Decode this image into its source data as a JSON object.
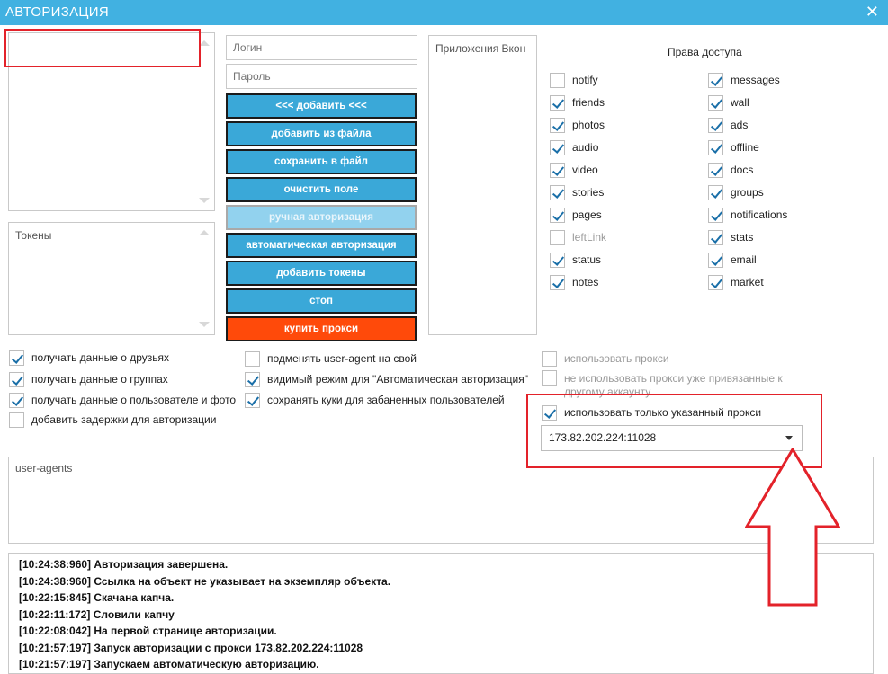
{
  "window": {
    "title": "АВТОРИЗАЦИЯ",
    "close_glyph": "✕"
  },
  "accounts_box": {
    "label": ""
  },
  "tokens_box": {
    "label": "Токены"
  },
  "apps_box": {
    "label": "Приложения Вкон"
  },
  "login": {
    "placeholder": "Логин",
    "value": ""
  },
  "password": {
    "placeholder": "Пароль",
    "value": ""
  },
  "buttons": {
    "add": "<<< добавить <<<",
    "add_from_file": "добавить из файла",
    "save_to_file": "сохранить в файл",
    "clear_field": "очистить поле",
    "manual_auth": "ручная авторизация",
    "auto_auth": "автоматическая авторизация",
    "add_tokens": "добавить токены",
    "stop": "стоп",
    "buy_proxy": "купить прокси"
  },
  "access": {
    "title": "Права доступа",
    "left": [
      {
        "label": "notify",
        "checked": false
      },
      {
        "label": "friends",
        "checked": true
      },
      {
        "label": "photos",
        "checked": true
      },
      {
        "label": "audio",
        "checked": true
      },
      {
        "label": "video",
        "checked": true
      },
      {
        "label": "stories",
        "checked": true
      },
      {
        "label": "pages",
        "checked": true
      },
      {
        "label": "leftLink",
        "checked": false
      },
      {
        "label": "status",
        "checked": true
      },
      {
        "label": "notes",
        "checked": true
      }
    ],
    "right": [
      {
        "label": "messages",
        "checked": true
      },
      {
        "label": "wall",
        "checked": true
      },
      {
        "label": "ads",
        "checked": true
      },
      {
        "label": "offline",
        "checked": true
      },
      {
        "label": "docs",
        "checked": true
      },
      {
        "label": "groups",
        "checked": true
      },
      {
        "label": "notifications",
        "checked": true
      },
      {
        "label": "stats",
        "checked": true
      },
      {
        "label": "email",
        "checked": true
      },
      {
        "label": "market",
        "checked": true
      }
    ]
  },
  "options": {
    "get_friends": {
      "label": "получать данные о друзьях",
      "checked": true
    },
    "get_groups": {
      "label": "получать данные о группах",
      "checked": true
    },
    "get_user_photo": {
      "label": "получать данные о пользователе и фото",
      "checked": true
    },
    "add_delays": {
      "label": "добавить задержки для авторизации",
      "checked": false
    },
    "replace_useragent": {
      "label": "подменять user-agent на свой",
      "checked": false
    },
    "visible_mode": {
      "label": "видимый режим для \"Автоматическая авторизация\"",
      "checked": true
    },
    "save_cookies": {
      "label": "сохранять куки для забаненных пользователей",
      "checked": true
    },
    "use_proxy": {
      "label": "использовать прокси",
      "checked": false
    },
    "no_bound_proxy": {
      "label": "не использовать прокси уже привязанные к другому аккаунту",
      "checked": false
    },
    "only_specified_proxy": {
      "label": "использовать только указанный прокси",
      "checked": true
    }
  },
  "proxy_select": {
    "value": "173.82.202.224:11028"
  },
  "useragents_box": {
    "label": "user-agents"
  },
  "log": [
    "[10:24:38:960]  Авторизация завершена.",
    "[10:24:38:960]  Ссылка на объект не указывает на экземпляр объекта.",
    "[10:22:15:845]  Скачана капча.",
    "[10:22:11:172]  Словили капчу",
    "[10:22:08:042]  На первой странице авторизации.",
    "[10:21:57:197]  Запуск авторизации с прокси 173.82.202.224:11028",
    "[10:21:57:197]  Запускаем автоматическую авторизацию."
  ],
  "colors": {
    "titlebar": "#41b1e1",
    "button": "#3aa8d8",
    "buy_button": "#ff4a0a",
    "annotation": "#e3222a"
  }
}
